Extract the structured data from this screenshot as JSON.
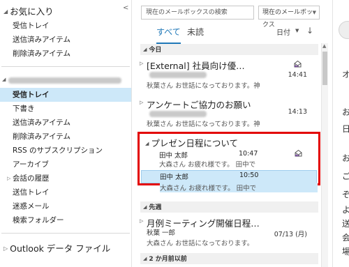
{
  "folder_pane": {
    "favorites": {
      "label": "お気に入り",
      "items": [
        "受信トレイ",
        "送信済みアイテム",
        "削除済みアイテム"
      ]
    },
    "account": {
      "items": [
        "受信トレイ",
        "下書き",
        "送信済みアイテム",
        "削除済みアイテム",
        "RSS のサブスクリプション",
        "アーカイブ",
        "会話の履歴",
        "送信トレイ",
        "迷惑メール",
        "検索フォルダー"
      ],
      "selected_index": 0,
      "expandable_index": 6
    },
    "data_file_label": "Outlook データ ファイル"
  },
  "list_pane": {
    "search_placeholder": "現在のメールボックスの検索",
    "scope_label": "現在のメールボックス",
    "tabs": [
      "すべて",
      "未読"
    ],
    "sort_label": "日付",
    "sort_arrow": "↓",
    "groups": [
      "今日",
      "先週",
      "2 か月前以前"
    ],
    "messages": [
      {
        "title": "[External] 社員向け優…",
        "preview": "秋葉さん  お世話になっております。神",
        "time": "14:41",
        "sender_redacted": true
      },
      {
        "title": "アンケートご協力のお願い",
        "preview": "秋葉さん  お世話になっております。神",
        "time": "14:13",
        "sender_redacted": true
      },
      {
        "title": "月例ミーティング開催日程…",
        "sender": "秋葉 一郎",
        "preview": "大森さん  お世話になっております。",
        "time": "07/13 (月)"
      }
    ],
    "thread": {
      "title": "プレゼン日程について",
      "items": [
        {
          "sender": "田中 太郎",
          "time": "10:47",
          "preview": "大森さん  お疲れ様です。 田中で"
        },
        {
          "sender": "田中 太郎",
          "time": "10:50",
          "preview": "大森さん  お疲れ様です。 田中で"
        }
      ]
    }
  },
  "reading_pane": {
    "fragments": [
      "オ",
      "お",
      "日",
      "お",
      "ご",
      "ぞ",
      "よ",
      "送",
      "会",
      "場"
    ]
  },
  "colors": {
    "accent": "#1f78b8",
    "selected_bg": "#cde8f9",
    "highlight_border": "#e30000",
    "icon_purple": "#7b4ea3"
  }
}
